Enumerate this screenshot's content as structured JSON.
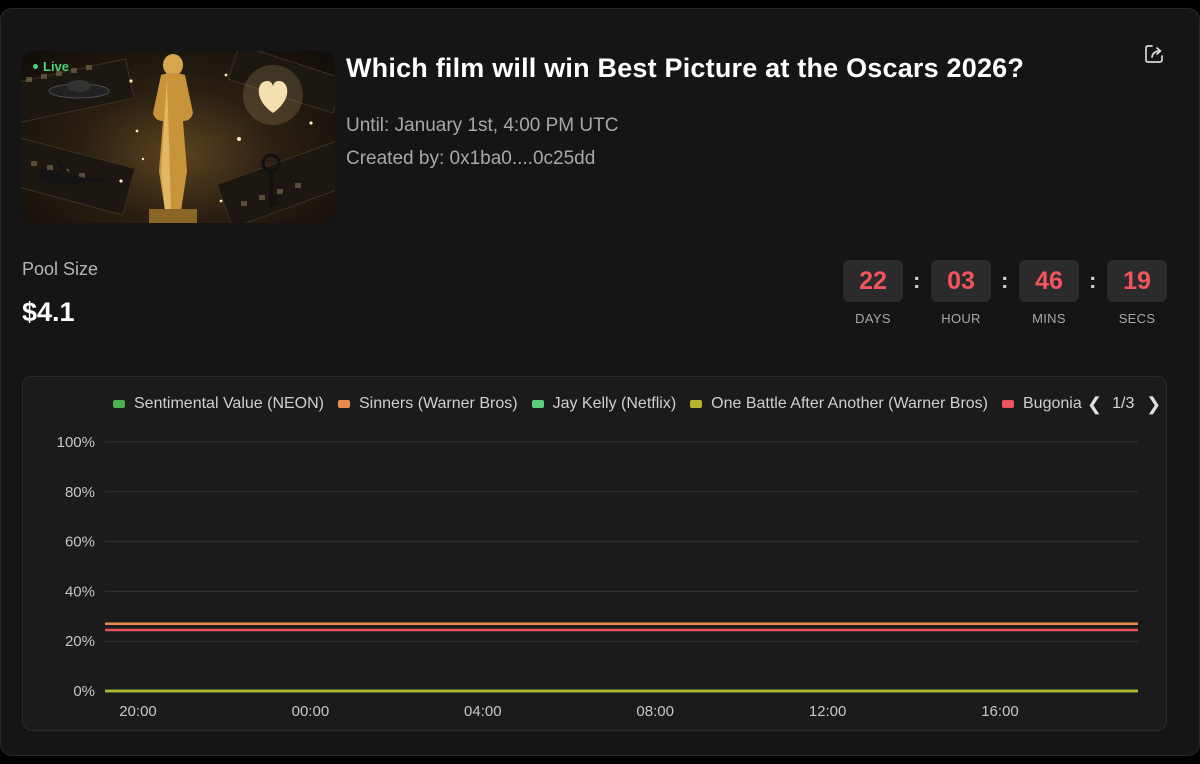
{
  "market": {
    "status_badge": "Live",
    "title": "Which film will win Best Picture at the Oscars 2026?",
    "until": "Until: January 1st, 4:00 PM UTC",
    "created_by": "Created by: 0x1ba0....0c25dd",
    "share_icon": "share-icon"
  },
  "pool": {
    "label": "Pool Size",
    "value": "$4.1"
  },
  "countdown": {
    "days": "22",
    "days_label": "DAYS",
    "hours": "03",
    "hours_label": "HOUR",
    "mins": "46",
    "mins_label": "MINS",
    "secs": "19",
    "secs_label": "SECS",
    "separator": ":"
  },
  "legend": {
    "items": [
      {
        "label": "Sentimental Value (NEON)",
        "color": "#4caf50"
      },
      {
        "label": "Sinners (Warner Bros)",
        "color": "#e8894f"
      },
      {
        "label": "Jay Kelly (Netflix)",
        "color": "#5ccf7e"
      },
      {
        "label": "One Battle After Another (Warner Bros)",
        "color": "#b5b52e"
      },
      {
        "label": "Bugonia",
        "color": "#e85460"
      }
    ],
    "page": "1/3",
    "prev_icon": "chevron-left-icon",
    "next_icon": "chevron-right-icon"
  },
  "chart_data": {
    "type": "line",
    "x": [
      "20:00",
      "00:00",
      "04:00",
      "08:00",
      "12:00",
      "16:00"
    ],
    "ylim": [
      0,
      100
    ],
    "yticks": [
      "0%",
      "20%",
      "40%",
      "60%",
      "80%",
      "100%"
    ],
    "grid": true,
    "legend_position": "top",
    "series": [
      {
        "name": "Sentimental Value (NEON)",
        "color": "#4caf50",
        "values": [
          0,
          0,
          0,
          0,
          0,
          0
        ]
      },
      {
        "name": "Sinners (Warner Bros)",
        "color": "#e8894f",
        "values": [
          27,
          27,
          27,
          27,
          27,
          27
        ]
      },
      {
        "name": "Jay Kelly (Netflix)",
        "color": "#5ccf7e",
        "values": [
          0,
          0,
          0,
          0,
          0,
          0
        ]
      },
      {
        "name": "One Battle After Another (Warner Bros)",
        "color": "#b5b52e",
        "values": [
          0,
          0,
          0,
          0,
          0,
          0
        ]
      },
      {
        "name": "Bugonia",
        "color": "#e85460",
        "values": [
          24.5,
          24.5,
          24.5,
          24.5,
          24.5,
          24.5
        ]
      }
    ]
  }
}
